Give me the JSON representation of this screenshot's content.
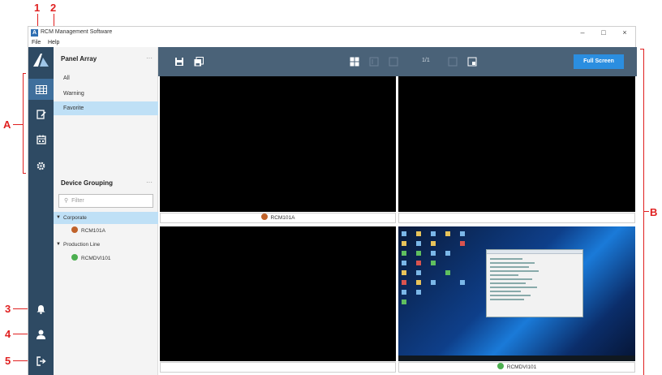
{
  "annotations": {
    "n1": "1",
    "n2": "2",
    "nA": "A",
    "nB": "B",
    "n3": "3",
    "n4": "4",
    "n5": "5"
  },
  "window": {
    "title": "RCM Management Software",
    "app_icon_letter": "A",
    "minimize": "–",
    "maximize": "□",
    "close": "×"
  },
  "menu": {
    "file": "File",
    "help": "Help"
  },
  "rail": {
    "items": [
      {
        "icon": "grid-icon",
        "active": true
      },
      {
        "icon": "edit-icon",
        "active": false
      },
      {
        "icon": "calendar-icon",
        "active": false
      },
      {
        "icon": "gear-icon",
        "active": false
      }
    ],
    "bottom": [
      {
        "icon": "bell-icon"
      },
      {
        "icon": "user-icon"
      },
      {
        "icon": "logout-icon"
      }
    ]
  },
  "panel_array": {
    "title": "Panel Array",
    "more": "···",
    "items": [
      "All",
      "Warning",
      "Favorite"
    ],
    "selected_index": 2
  },
  "device_grouping": {
    "title": "Device Grouping",
    "more": "···",
    "filter_placeholder": "Filter",
    "groups": [
      {
        "name": "Corporate",
        "devices": [
          {
            "name": "RCM101A",
            "status_color": "#c0622a"
          }
        ]
      },
      {
        "name": "Production Line",
        "devices": [
          {
            "name": "RCMDVI101",
            "status_color": "#4caf50"
          }
        ]
      }
    ]
  },
  "toolbar": {
    "page_indicator": "1/1",
    "full_screen_label": "Full Screen"
  },
  "cells": [
    {
      "label": "RCM101A",
      "status_color": "#c0622a",
      "content": "black"
    },
    {
      "label": "",
      "status_color": "",
      "content": "black"
    },
    {
      "label": "",
      "status_color": "",
      "content": "black"
    },
    {
      "label": "RCMDVI101",
      "status_color": "#4caf50",
      "content": "desktop"
    }
  ],
  "colors": {
    "annotation": "#e02020",
    "rail": "#2e4a63",
    "toolbar": "#4a6278",
    "selection": "#bfe0f6",
    "accent_button": "#2b8ee0"
  }
}
